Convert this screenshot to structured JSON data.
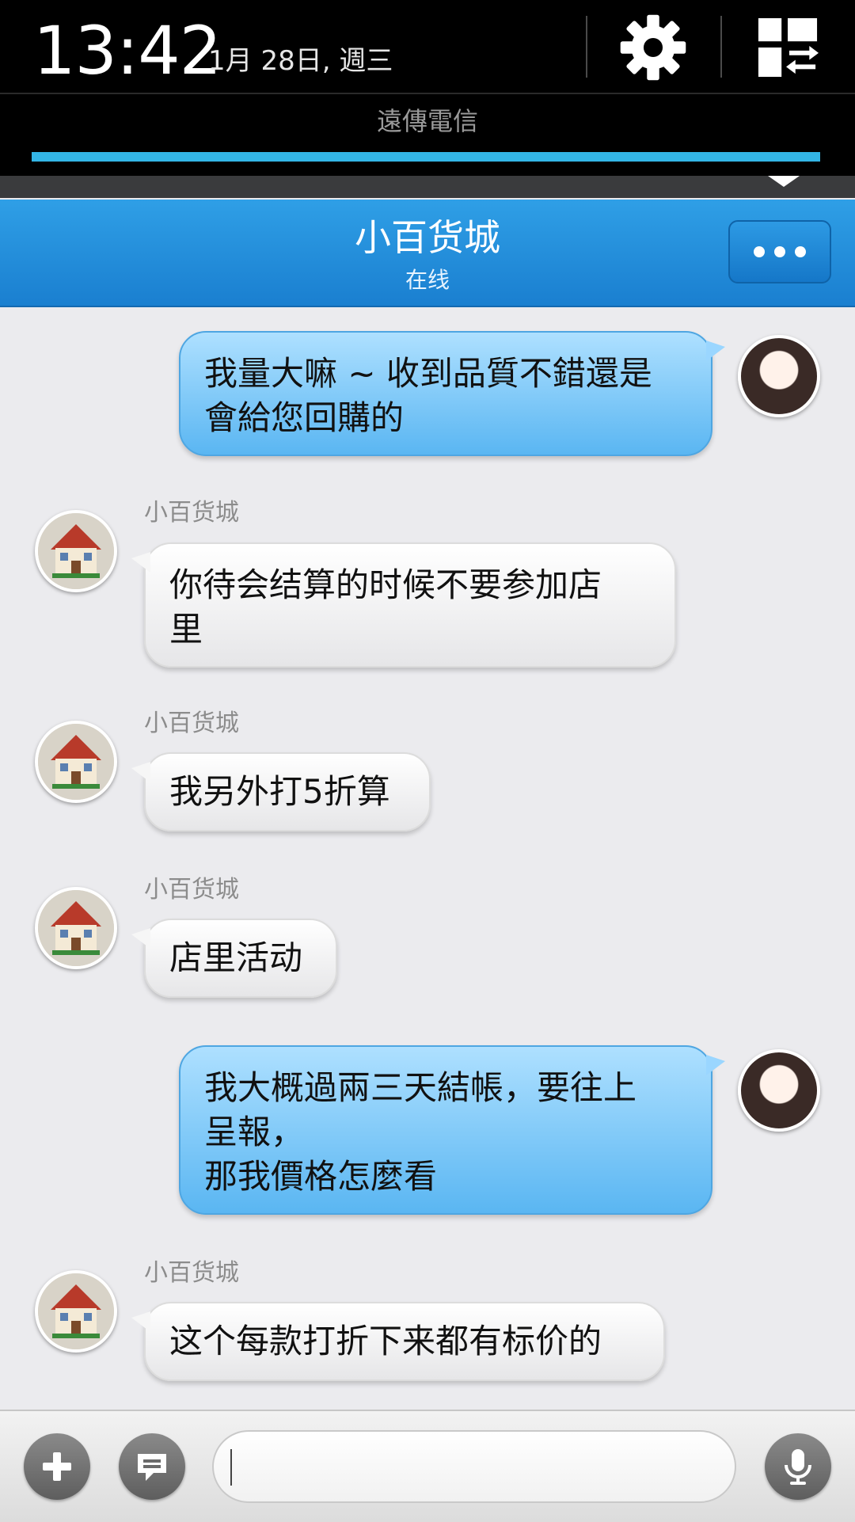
{
  "status_shade": {
    "time": "13:42",
    "date": "1月 28日, 週三",
    "carrier": "遠傳電信",
    "icons": [
      "gear-icon",
      "quick-settings-toggle-icon"
    ]
  },
  "chat": {
    "title": "小百货城",
    "status": "在线",
    "more_icon": "ellipsis-icon"
  },
  "messages": [
    {
      "direction": "outgoing",
      "text": "我量大嘛 ~ 收到品質不錯還是\n會給您回購的"
    },
    {
      "direction": "incoming",
      "sender": "小百货城",
      "text": "你待会结算的时候不要参加店\n里"
    },
    {
      "direction": "incoming",
      "sender": "小百货城",
      "text": "我另外打5折算"
    },
    {
      "direction": "incoming",
      "sender": "小百货城",
      "text": "店里活动"
    },
    {
      "direction": "outgoing",
      "text": "我大概過兩三天結帳，要往上\n呈報，\n那我價格怎麼看"
    },
    {
      "direction": "incoming",
      "sender": "小百货城",
      "text": "这个每款打折下来都有标价的"
    }
  ],
  "input_bar": {
    "message_value": "",
    "icons": [
      "plus-icon",
      "quick-reply-icon",
      "microphone-icon"
    ]
  },
  "colors": {
    "header_blue": "#1a8ad8",
    "outgoing_bubble": "#6cc0f5",
    "incoming_bubble": "#f4f4f4",
    "chat_background": "#ebebee",
    "progress_blue": "#33b5e5"
  }
}
